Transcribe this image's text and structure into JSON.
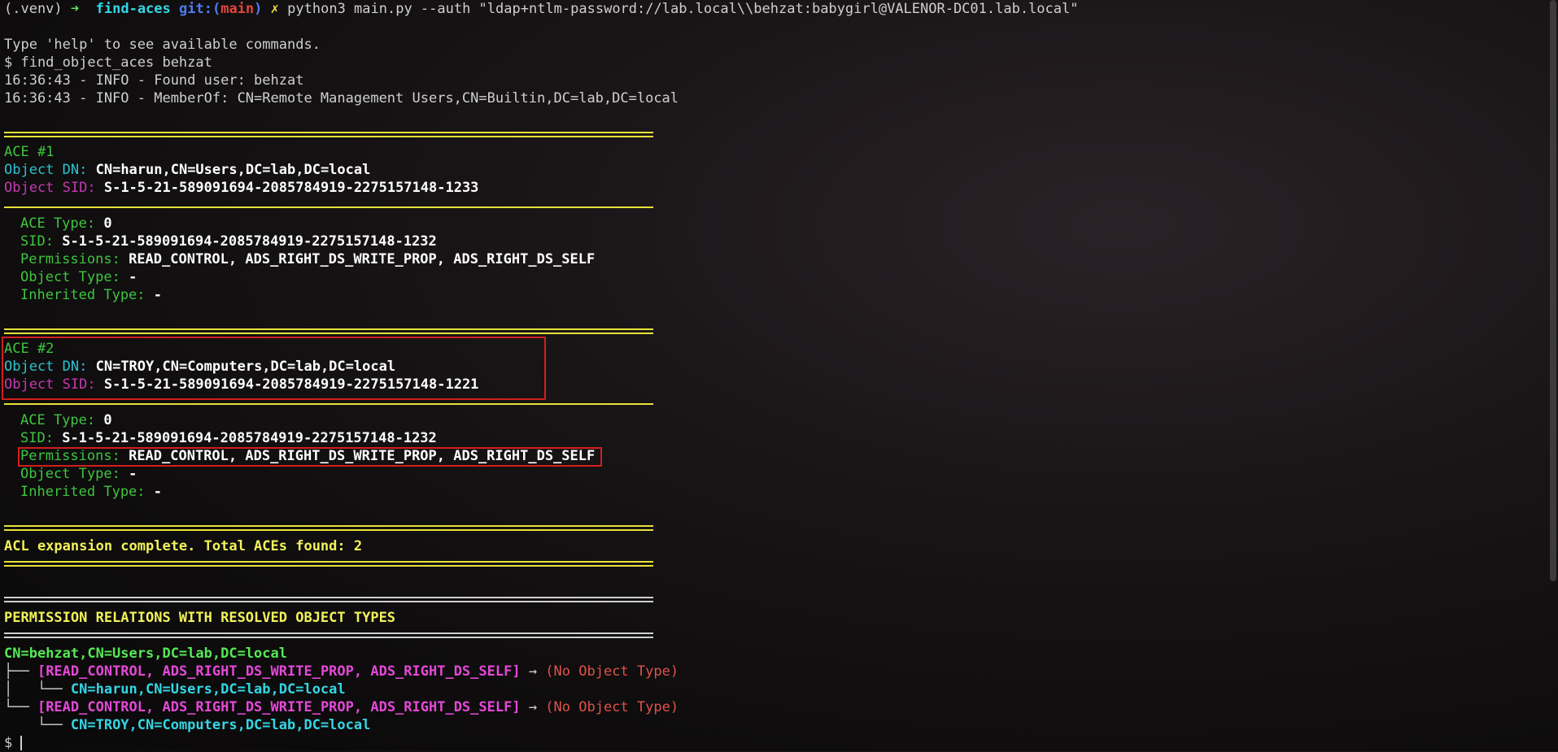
{
  "prompt": {
    "venv": "(.venv)",
    "arrow": "➜",
    "dir": "find-aces",
    "git_label": "git:(",
    "branch": "main",
    "git_close": ")",
    "dirty": "✗",
    "command": "python3 main.py --auth \"ldap+ntlm-password://lab.local\\\\behzat:babygirl@VALENOR-DC01.lab.local\""
  },
  "help_line": "Type 'help' to see available commands.",
  "user_command": "$ find_object_aces behzat",
  "log": [
    "16:36:43 - INFO - Found user: behzat",
    "16:36:43 - INFO - MemberOf: CN=Remote Management Users,CN=Builtin,DC=lab,DC=local"
  ],
  "labels": {
    "object_dn": "Object DN:",
    "object_sid": "Object SID:",
    "ace_type": "ACE Type:",
    "sid": "SID:",
    "permissions": "Permissions:",
    "object_type": "Object Type:",
    "inherited_type": "Inherited Type:"
  },
  "aces": [
    {
      "header": "ACE #1",
      "object_dn": "CN=harun,CN=Users,DC=lab,DC=local",
      "object_sid": "S-1-5-21-589091694-2085784919-2275157148-1233",
      "ace_type": "0",
      "sid": "S-1-5-21-589091694-2085784919-2275157148-1232",
      "permissions": "READ_CONTROL, ADS_RIGHT_DS_WRITE_PROP, ADS_RIGHT_DS_SELF",
      "object_type": "-",
      "inherited_type": "-"
    },
    {
      "header": "ACE #2",
      "object_dn": "CN=TROY,CN=Computers,DC=lab,DC=local",
      "object_sid": "S-1-5-21-589091694-2085784919-2275157148-1221",
      "ace_type": "0",
      "sid": "S-1-5-21-589091694-2085784919-2275157148-1232",
      "permissions": "READ_CONTROL, ADS_RIGHT_DS_WRITE_PROP, ADS_RIGHT_DS_SELF",
      "object_type": "-",
      "inherited_type": "-"
    }
  ],
  "summary": "ACL expansion complete. Total ACEs found: 2",
  "relations": {
    "heading": "PERMISSION RELATIONS WITH RESOLVED OBJECT TYPES",
    "root": "CN=behzat,CN=Users,DC=lab,DC=local",
    "branches": [
      {
        "prefix": "├── ",
        "perms": "[READ_CONTROL, ADS_RIGHT_DS_WRITE_PROP, ADS_RIGHT_DS_SELF]",
        "arrow": " → ",
        "type": "(No Object Type)",
        "child_prefix": "│   └── ",
        "target": "CN=harun,CN=Users,DC=lab,DC=local"
      },
      {
        "prefix": "└── ",
        "perms": "[READ_CONTROL, ADS_RIGHT_DS_WRITE_PROP, ADS_RIGHT_DS_SELF]",
        "arrow": " → ",
        "type": "(No Object Type)",
        "child_prefix": "    └── ",
        "target": "CN=TROY,CN=Computers,DC=lab,DC=local"
      }
    ]
  },
  "final_prompt": "$ "
}
